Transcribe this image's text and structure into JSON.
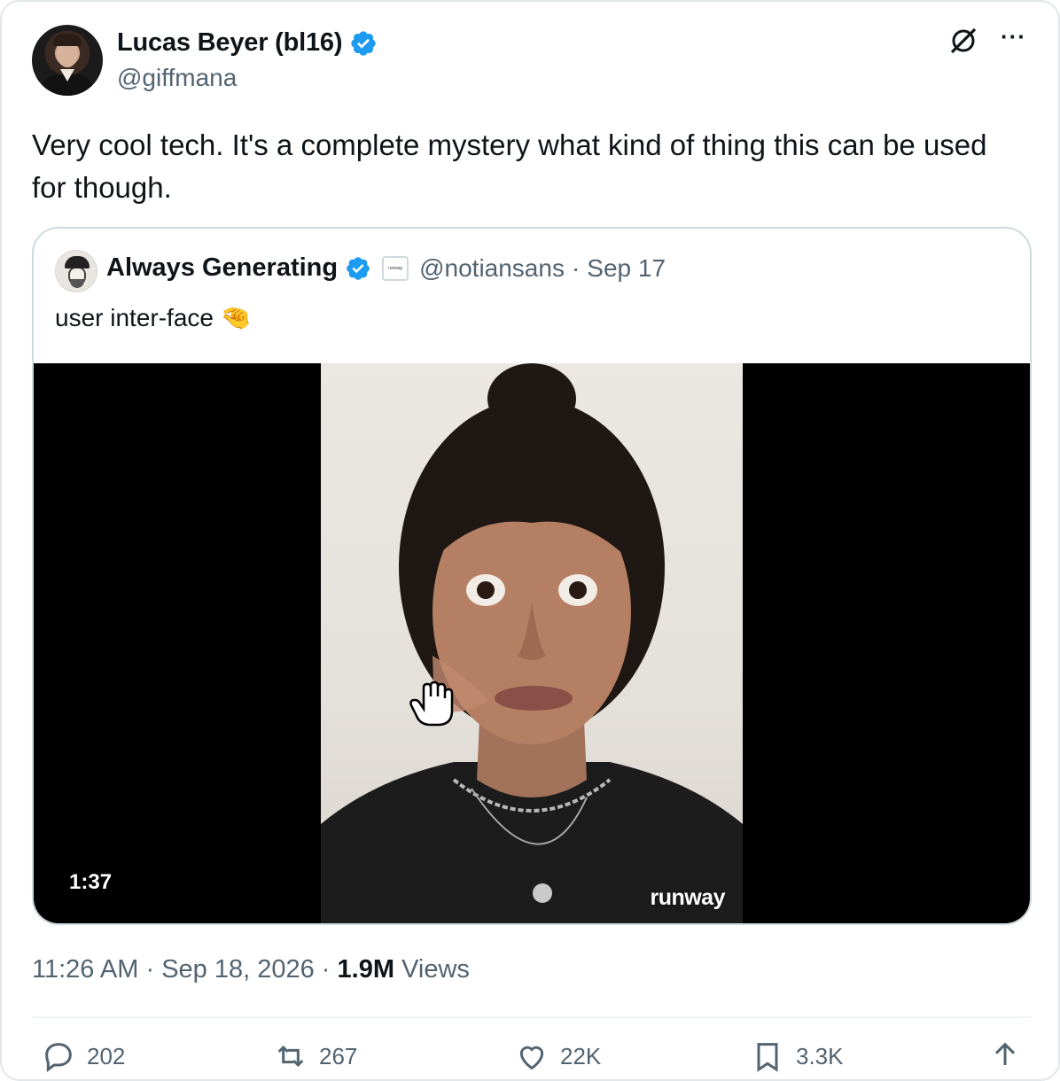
{
  "author": {
    "name": "Lucas Beyer (bl16)",
    "handle": "@giffmana",
    "verified": true
  },
  "tweet_text": "Very cool tech. It's a complete mystery what kind of thing this can be used for though.",
  "quoted": {
    "name": "Always Generating",
    "verified": true,
    "affiliate_badge": "runway",
    "handle": "@notiansans",
    "separator": "·",
    "date": "Sep 17",
    "text": "user inter-face 🤏",
    "video": {
      "duration": "1:37",
      "watermark": "runway"
    }
  },
  "meta": {
    "time": "11:26 AM",
    "sep1": "·",
    "date": "Sep 18, 2026",
    "sep2": "·",
    "views_count": "1.9M",
    "views_label": "Views"
  },
  "actions": {
    "replies": "202",
    "reposts": "267",
    "likes": "22K",
    "bookmarks": "3.3K"
  },
  "colors": {
    "verified_blue": "#1d9bf0",
    "secondary_text": "#536471",
    "primary_text": "#0f1419",
    "border": "#cfd9de"
  },
  "icons": [
    "verified-badge-icon",
    "grok-icon",
    "more-options-icon",
    "reply-icon",
    "repost-icon",
    "like-icon",
    "bookmark-icon",
    "share-icon"
  ]
}
